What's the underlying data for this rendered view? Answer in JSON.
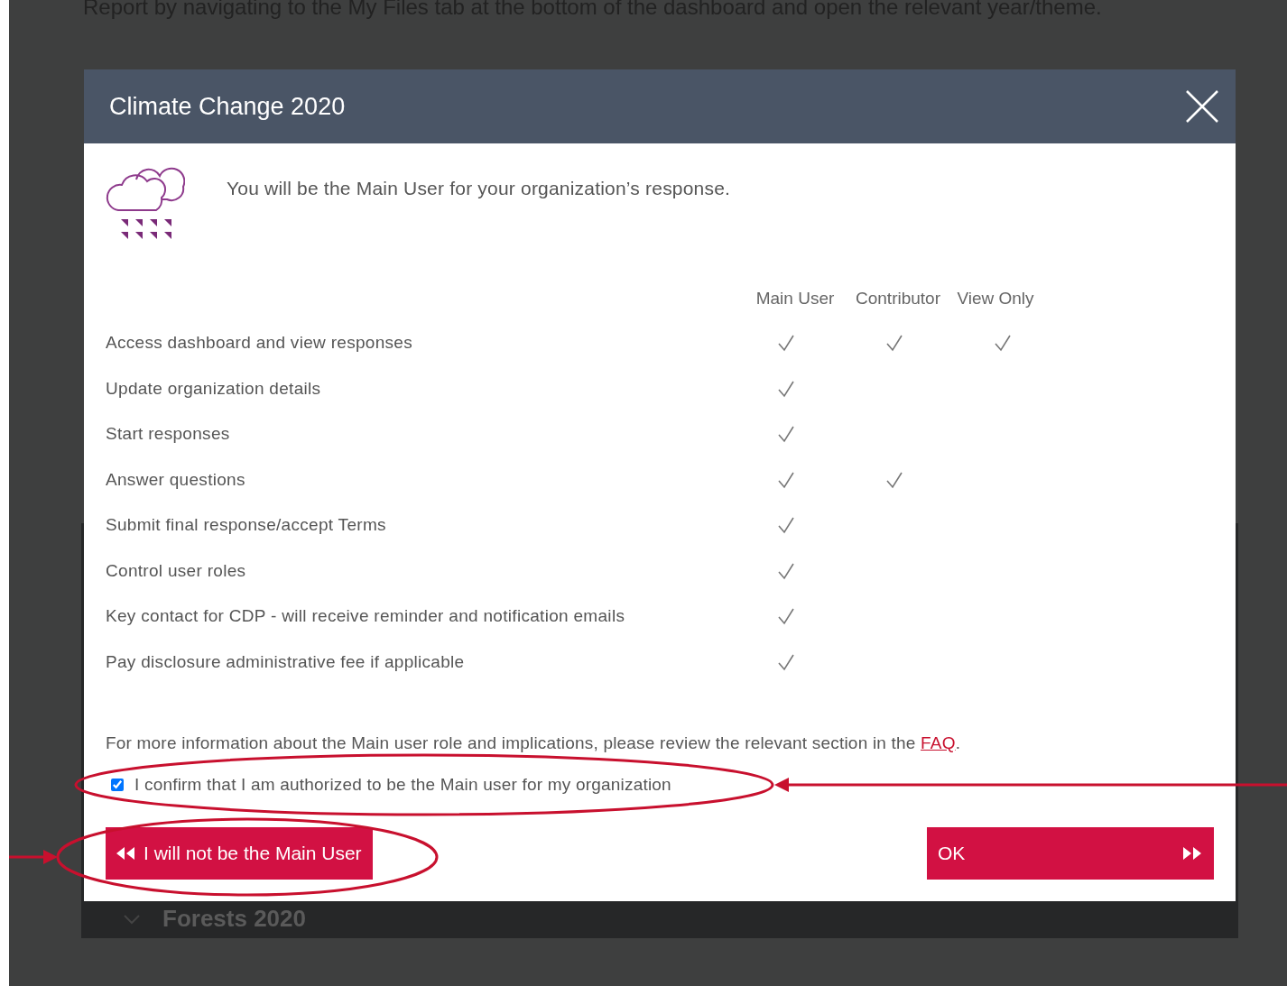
{
  "background": {
    "text": "Report by navigating to the My Files tab at the bottom of the dashboard and open the relevant year/theme.",
    "section": "Forests 2020"
  },
  "dialog": {
    "title": "Climate Change 2020",
    "intro": "You will be the Main User for your organization’s response.",
    "columns": [
      "Main User",
      "Contributor",
      "View Only"
    ],
    "rows": [
      {
        "label": "Access dashboard and view responses",
        "main_user": true,
        "contributor": true,
        "view_only": true
      },
      {
        "label": "Update organization details",
        "main_user": true,
        "contributor": false,
        "view_only": false
      },
      {
        "label": "Start responses",
        "main_user": true,
        "contributor": false,
        "view_only": false
      },
      {
        "label": "Answer questions",
        "main_user": true,
        "contributor": true,
        "view_only": false
      },
      {
        "label": "Submit final response/accept Terms",
        "main_user": true,
        "contributor": false,
        "view_only": false
      },
      {
        "label": "Control user roles",
        "main_user": true,
        "contributor": false,
        "view_only": false
      },
      {
        "label": "Key contact for CDP - will receive reminder and notification emails",
        "main_user": true,
        "contributor": false,
        "view_only": false
      },
      {
        "label": "Pay disclosure administrative fee if applicable",
        "main_user": true,
        "contributor": false,
        "view_only": false
      }
    ],
    "info": "For more information about the Main user role and implications, please review the relevant section in the",
    "info_link": "FAQ",
    "info_end": ".",
    "confirm": {
      "label": "I confirm that I am authorized to be the Main user for my organization",
      "checked": true
    },
    "decline_button": "I will not be the Main User",
    "ok_button": "OK"
  }
}
